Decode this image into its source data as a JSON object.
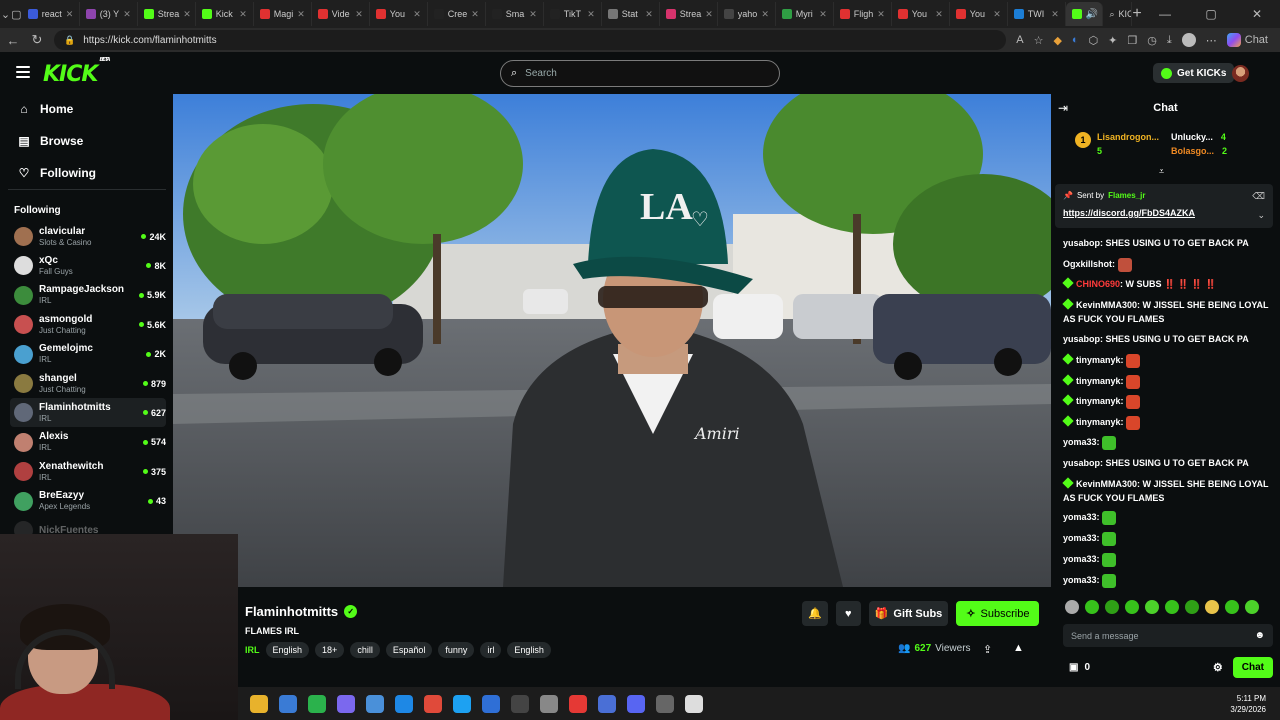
{
  "browser": {
    "tabs": [
      {
        "label": "react",
        "color": "#3b5bdb"
      },
      {
        "label": "(3) Y",
        "color": "#8e44ad"
      },
      {
        "label": "Strea",
        "color": "#53fc18"
      },
      {
        "label": "Kick",
        "color": "#53fc18"
      },
      {
        "label": "Magi",
        "color": "#e03131"
      },
      {
        "label": "Vide",
        "color": "#e03131"
      },
      {
        "label": "You",
        "color": "#e03131"
      },
      {
        "label": "Cree",
        "color": "#222222"
      },
      {
        "label": "Sma",
        "color": "#222222"
      },
      {
        "label": "TikT",
        "color": "#222222"
      },
      {
        "label": "Stat",
        "color": "#777777"
      },
      {
        "label": "Strea",
        "color": "#d6336c"
      },
      {
        "label": "yaho",
        "color": "#444444"
      },
      {
        "label": "Myri",
        "color": "#2f9e44"
      },
      {
        "label": "Fligh",
        "color": "#e03131"
      },
      {
        "label": "You",
        "color": "#e03131"
      },
      {
        "label": "You",
        "color": "#e03131"
      },
      {
        "label": "TWI",
        "color": "#1c7ed6"
      }
    ],
    "active_tab_label": "",
    "kick_tab_label": "KICK",
    "url": "https://kick.com/flaminhotmitts"
  },
  "nav": {
    "logo": "KICK",
    "logo_badge": "BETA",
    "search_placeholder": "Search",
    "get_kicks": "Get KICKs"
  },
  "sidebar": {
    "main": [
      {
        "label": "Home",
        "icon": "home-icon"
      },
      {
        "label": "Browse",
        "icon": "browse-icon"
      },
      {
        "label": "Following",
        "icon": "heart-icon"
      }
    ],
    "following_heading": "Following",
    "channels": [
      {
        "name": "clavicular",
        "category": "Slots & Casino",
        "viewers": "24K",
        "color": "#a07050"
      },
      {
        "name": "xQc",
        "category": "Fall Guys",
        "viewers": "8K",
        "color": "#dddddd"
      },
      {
        "name": "RampageJackson",
        "category": "IRL",
        "viewers": "5.9K",
        "color": "#3c8c3c"
      },
      {
        "name": "asmongold",
        "category": "Just Chatting",
        "viewers": "5.6K",
        "color": "#c85050"
      },
      {
        "name": "Gemelojmc",
        "category": "IRL",
        "viewers": "2K",
        "color": "#4aa0d0"
      },
      {
        "name": "shangel",
        "category": "Just Chatting",
        "viewers": "879",
        "color": "#8a7a40"
      },
      {
        "name": "Flaminhotmitts",
        "category": "IRL",
        "viewers": "627",
        "color": "#606878"
      },
      {
        "name": "Alexis",
        "category": "IRL",
        "viewers": "574",
        "color": "#c08070"
      },
      {
        "name": "Xenathewitch",
        "category": "IRL",
        "viewers": "375",
        "color": "#b04040"
      },
      {
        "name": "BreEazyy",
        "category": "Apex Legends",
        "viewers": "43",
        "color": "#40a060"
      },
      {
        "name": "NickFuentes",
        "category": "",
        "viewers": "",
        "color": "#555555"
      }
    ]
  },
  "stream": {
    "streamer": "Flaminhotmitts",
    "title": "FLAMES IRL",
    "category": "IRL",
    "tags": [
      "English",
      "18+",
      "chill",
      "Español",
      "funny",
      "irl",
      "English"
    ],
    "gift_subs": "Gift Subs",
    "subscribe": "Subscribe",
    "viewers": "627",
    "viewers_label": "Viewers",
    "shirt_text": "Amiri"
  },
  "chat": {
    "title": "Chat",
    "leaderboard": [
      {
        "name": "Lisandrogon...",
        "count": "5"
      },
      {
        "name": "Unlucky...",
        "count": "4"
      },
      {
        "name": "Bolasgo...",
        "count": "2"
      }
    ],
    "pinned": {
      "sent_by_label": "Sent by",
      "sender": "Flames_jr",
      "link": "https://discord.gg/FbDS4AZKA"
    },
    "messages": [
      {
        "user": "yusabop",
        "text": "SHES USING U TO GET BACK PA",
        "badge": false,
        "emote": "",
        "user_color": "#ffffff"
      },
      {
        "user": "Ogxkillshot",
        "text": "",
        "badge": false,
        "emote": "#c0503c",
        "user_color": "#ffffff"
      },
      {
        "user": "CHINO690",
        "text": "W SUBS ‼️ ‼️ ‼️ ‼️",
        "badge": true,
        "emote": "",
        "user_color": "#ff3b3b"
      },
      {
        "user": "KevinMMA300",
        "text": "W JISSEL SHE BEING LOYAL AS FUCK YOU FLAMES",
        "badge": true,
        "emote": "",
        "user_color": "#ffffff"
      },
      {
        "user": "yusabop",
        "text": "SHES USING U TO GET BACK PA",
        "badge": false,
        "emote": "",
        "user_color": "#ffffff"
      },
      {
        "user": "tinymanyk",
        "text": "",
        "badge": true,
        "emote": "#d9462a",
        "user_color": "#ffffff"
      },
      {
        "user": "tinymanyk",
        "text": "",
        "badge": true,
        "emote": "#d9462a",
        "user_color": "#ffffff"
      },
      {
        "user": "tinymanyk",
        "text": "",
        "badge": true,
        "emote": "#d9462a",
        "user_color": "#ffffff"
      },
      {
        "user": "tinymanyk",
        "text": "",
        "badge": true,
        "emote": "#d9462a",
        "user_color": "#ffffff"
      },
      {
        "user": "yoma33",
        "text": "",
        "badge": false,
        "emote": "#3fbf2a",
        "user_color": "#ffffff"
      },
      {
        "user": "yusabop",
        "text": "SHES USING U TO GET BACK PA",
        "badge": false,
        "emote": "",
        "user_color": "#ffffff"
      },
      {
        "user": "KevinMMA300",
        "text": "W JISSEL SHE BEING LOYAL AS FUCK YOU FLAMES",
        "badge": true,
        "emote": "",
        "user_color": "#ffffff"
      },
      {
        "user": "yoma33",
        "text": "",
        "badge": false,
        "emote": "#3fbf2a",
        "user_color": "#ffffff"
      },
      {
        "user": "yoma33",
        "text": "",
        "badge": false,
        "emote": "#3fbf2a",
        "user_color": "#ffffff"
      },
      {
        "user": "yoma33",
        "text": "",
        "badge": false,
        "emote": "#3fbf2a",
        "user_color": "#ffffff"
      },
      {
        "user": "yoma33",
        "text": "",
        "badge": false,
        "emote": "#3fbf2a",
        "user_color": "#ffffff"
      }
    ],
    "input_placeholder": "Send a message",
    "kicks_count": "0",
    "chat_button": "Chat"
  },
  "taskbar": {
    "time": "5:11 PM",
    "date": "3/29/2026",
    "icons": [
      "#e8b22c",
      "#3a7bd5",
      "#2bb24c",
      "#7b68ee",
      "#4a90d9",
      "#1e88e5",
      "#e04a3a",
      "#1da1f2",
      "#2f6fd6",
      "#444444",
      "#888888",
      "#e53935",
      "#4a6fd6",
      "#5865f2",
      "#666666",
      "#dddddd"
    ]
  },
  "colors": {
    "accent": "#53fc18",
    "background": "#0b0e0f",
    "panel": "#24292b"
  }
}
